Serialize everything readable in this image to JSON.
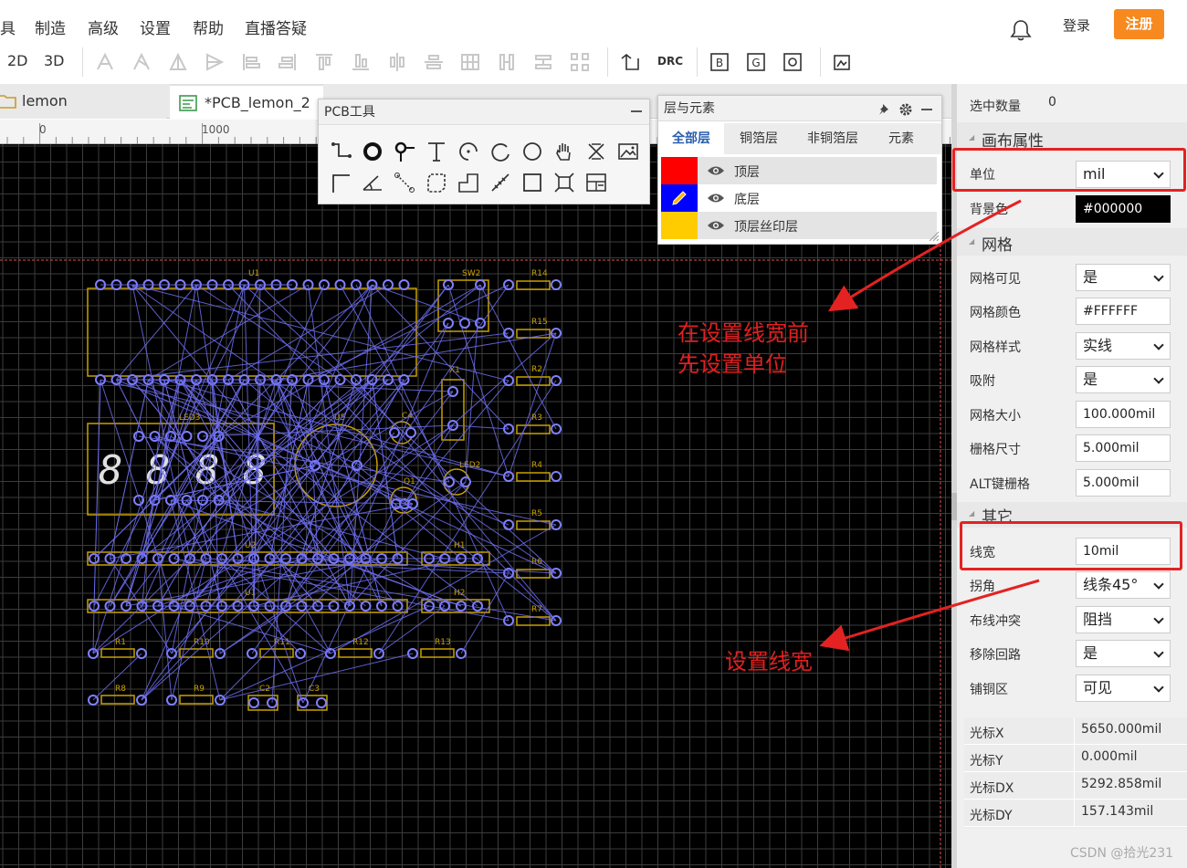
{
  "menu": [
    "具",
    "制造",
    "高级",
    "设置",
    "帮助",
    "直播答疑"
  ],
  "header": {
    "login": "登录",
    "register": "注册"
  },
  "toolbar": {
    "view_2d": "2D",
    "view_3d": "3D",
    "drc": "DRC"
  },
  "tabs": [
    {
      "label": "lemon"
    },
    {
      "label": "*PCB_lemon_2"
    }
  ],
  "ruler": {
    "tick_0": "0",
    "tick_1000": "1000"
  },
  "pcb_tools": {
    "title": "PCB工具"
  },
  "layers_panel": {
    "title": "层与元素",
    "tabs": [
      "全部层",
      "铜箔层",
      "非铜箔层",
      "元素"
    ],
    "layers": [
      {
        "name": "顶层",
        "color": "#ff0000"
      },
      {
        "name": "底层",
        "color": "#0000ff"
      },
      {
        "name": "顶层丝印层",
        "color": "#ffcc00"
      }
    ]
  },
  "properties": {
    "selected_count_label": "选中数量",
    "selected_count": "0",
    "canvas_section": "画布属性",
    "unit_label": "单位",
    "unit": "mil",
    "bg_label": "背景色",
    "bg": "#000000",
    "grid_section": "网格",
    "grid_visible_label": "网格可见",
    "grid_visible": "是",
    "grid_color_label": "网格颜色",
    "grid_color": "#FFFFFF",
    "grid_style_label": "网格样式",
    "grid_style": "实线",
    "snap_label": "吸附",
    "snap": "是",
    "grid_size_label": "网格大小",
    "grid_size": "100.000mil",
    "snap_size_label": "栅格尺寸",
    "snap_size": "5.000mil",
    "alt_snap_label": "ALT键栅格",
    "alt_snap": "5.000mil",
    "other_section": "其它",
    "track_width_label": "线宽",
    "track_width": "10mil",
    "corner_label": "拐角",
    "corner": "线条45°",
    "conflict_label": "布线冲突",
    "conflict": "阻挡",
    "remove_loop_label": "移除回路",
    "remove_loop": "是",
    "copper_label": "铺铜区",
    "copper": "可见"
  },
  "cursor": [
    {
      "label": "光标X",
      "value": "5650.000mil"
    },
    {
      "label": "光标Y",
      "value": "0.000mil"
    },
    {
      "label": "光标DX",
      "value": "5292.858mil"
    },
    {
      "label": "光标DY",
      "value": "157.143mil"
    }
  ],
  "annotations": {
    "note1_line1": "在设置线宽前",
    "note1_line2": "先设置单位",
    "note2": "设置线宽"
  },
  "designators": {
    "u1": "U1",
    "sw2": "SW2",
    "r14": "R14",
    "r15": "R15",
    "r2": "R2",
    "x1": "X1",
    "r3": "R3",
    "led3": "LED3",
    "u5": "U5",
    "c4": "C4",
    "r4": "R4",
    "led2": "LED2",
    "q1": "Q1",
    "r5": "R5",
    "u2": "U2",
    "h1": "H1",
    "r6": "R6",
    "u1b": "U1",
    "h2": "H2",
    "r7": "R7",
    "r1": "R1",
    "r10": "R10",
    "r11": "R11",
    "r12": "R12",
    "r13": "R13",
    "r8": "R8",
    "r9": "R9",
    "c2": "C2",
    "c3": "C3"
  },
  "watermark": "CSDN @拾光231"
}
